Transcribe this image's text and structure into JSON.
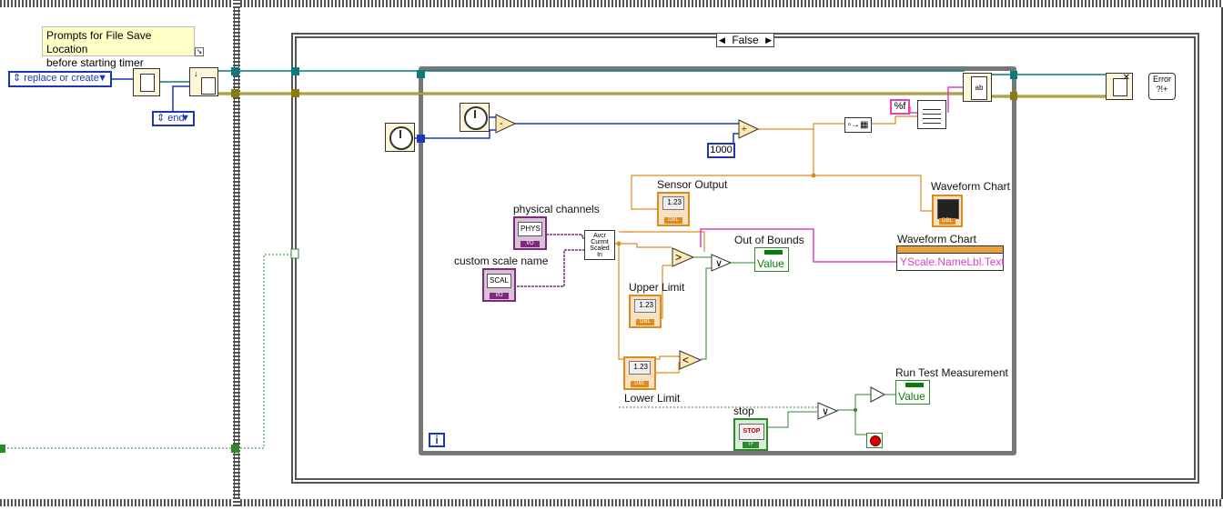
{
  "comment": {
    "line1": "Prompts for File Save Location",
    "line2": "before starting timer"
  },
  "open_mode_ring": "replace or create",
  "position_ring": "end",
  "case_selector": "False",
  "constant_1000": "1000",
  "format_string": "%f",
  "labels": {
    "sensor_output": "Sensor Output",
    "waveform_chart": "Waveform Chart",
    "waveform_chart_node": "Waveform Chart",
    "physical_channels": "physical channels",
    "custom_scale_name": "custom scale name",
    "out_of_bounds": "Out of Bounds",
    "upper_limit": "Upper Limit",
    "lower_limit": "Lower Limit",
    "stop": "stop",
    "run_test": "Run Test Measurement"
  },
  "property_node": "YScale.NameLbl.Text",
  "indicator_value": "Value",
  "numeric_display": "1.23",
  "dbl_tag": "DBL",
  "io_tag": "I/O",
  "tf_tag": "TF",
  "phys_text": "PHYS",
  "scal_text": "SCAL",
  "daq_vi_text": {
    "line1": "Avcr",
    "line2": "Currnt",
    "line3": "Scaled",
    "line4": "In"
  },
  "loop_iteration": "i",
  "stop_button_text": "STOP",
  "error_text": "Error",
  "colors": {
    "numeric": "#e08a1e",
    "boolean": "#2c8a2c",
    "string": "#e040c0",
    "io": "#7d2a7d",
    "integer": "#1d35b8",
    "file_ref": "#0a7a7a"
  }
}
